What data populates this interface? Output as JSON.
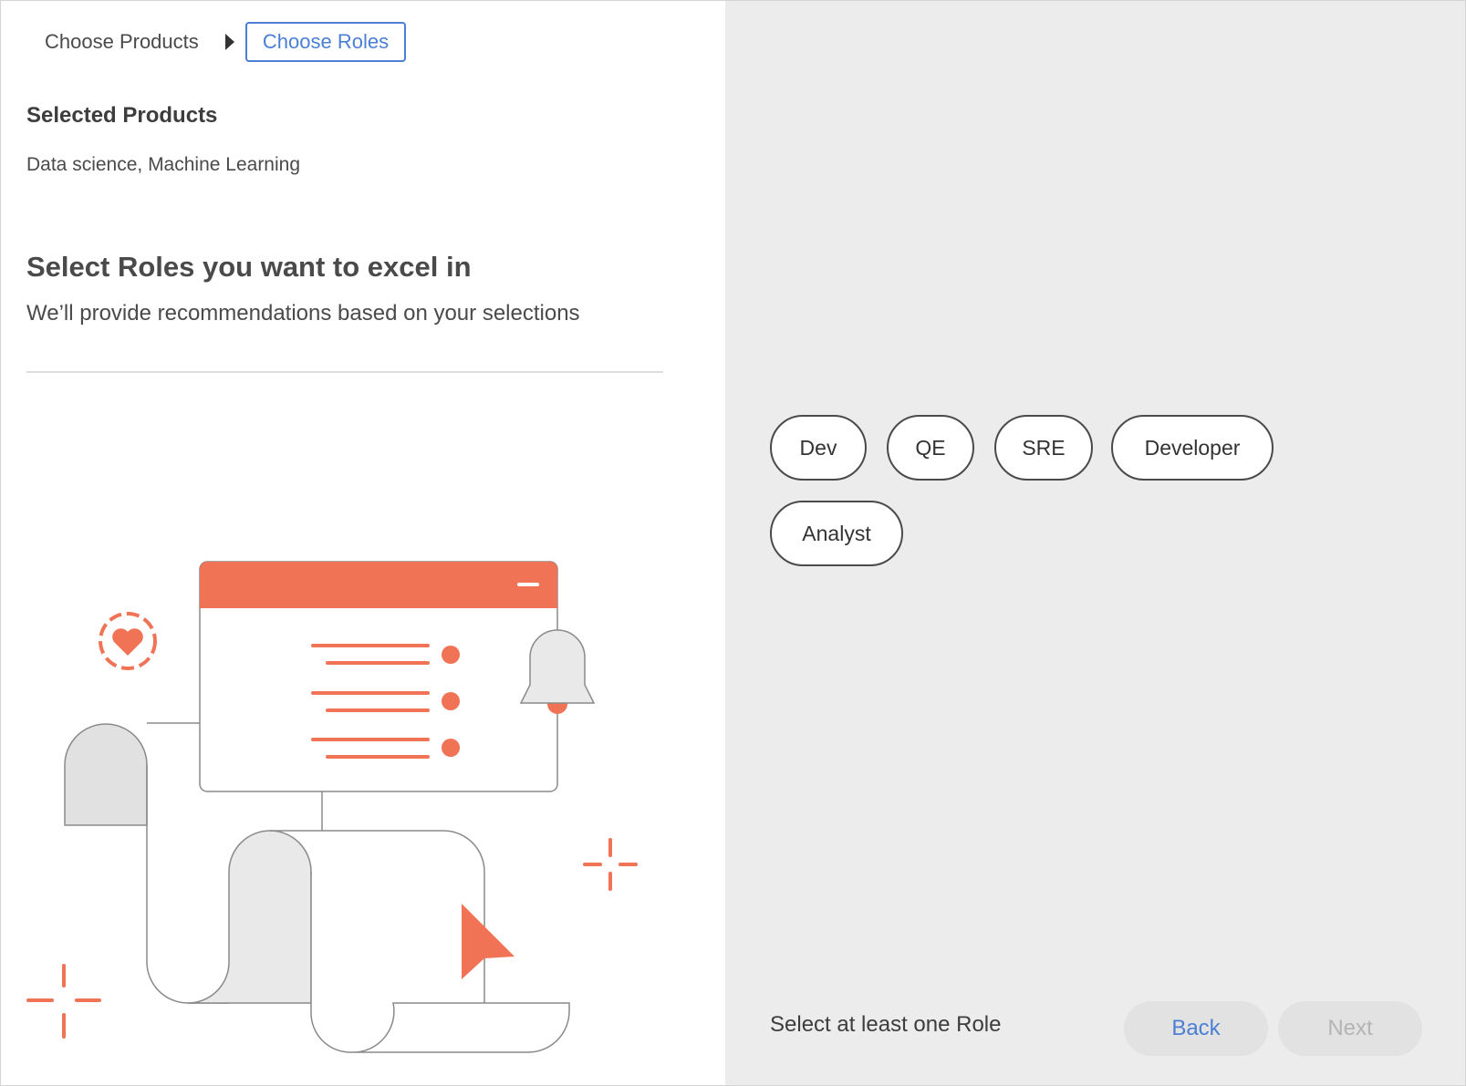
{
  "breadcrumb": {
    "step1": "Choose Products",
    "step2": "Choose Roles"
  },
  "selected_products": {
    "title": "Selected Products",
    "value": "Data science, Machine Learning"
  },
  "roles_section": {
    "heading": "Select Roles you want to excel in",
    "subheading": "We’ll provide recommendations based on your selections"
  },
  "roles": [
    "Dev",
    "QE",
    "SRE",
    "Developer",
    "Analyst"
  ],
  "footer": {
    "hint": "Select at least one Role",
    "back_label": "Back",
    "next_label": "Next"
  },
  "colors": {
    "accent": "#4a7fd4",
    "illustration": "#f07356",
    "panel_bg": "#ececec"
  }
}
